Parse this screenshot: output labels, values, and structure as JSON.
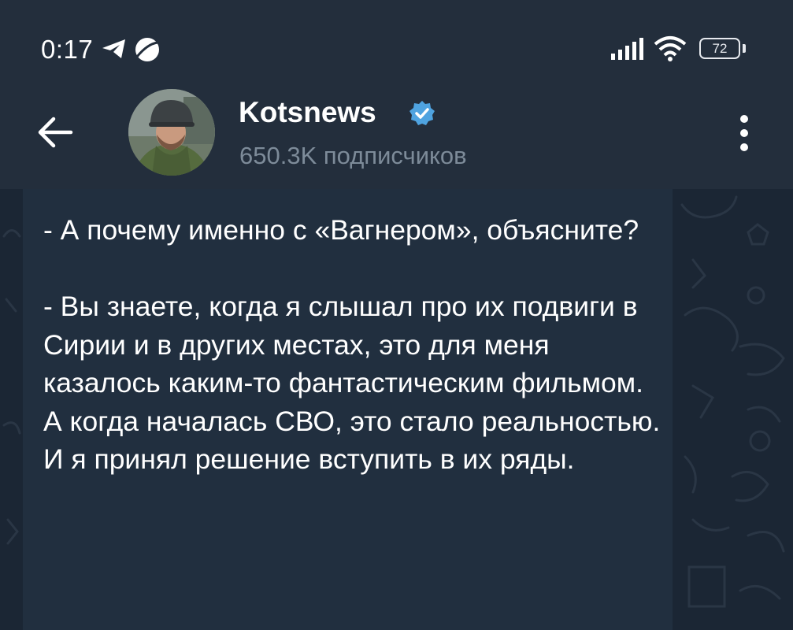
{
  "status_bar": {
    "time": "0:17",
    "battery": "72",
    "icons": [
      "telegram-icon",
      "orbit-icon",
      "signal-icon",
      "wifi-icon",
      "battery-icon"
    ]
  },
  "header": {
    "channel_name": "Kotsnews",
    "subscribers": "650.3K подписчиков",
    "icons": [
      "back-arrow-icon",
      "verified-icon",
      "more-vert-icon"
    ]
  },
  "message": {
    "paragraphs": [
      "- А почему именно с «Вагнером», объясните?",
      "- Вы знаете, когда я слышал про их подвиги в Сирии и в других местах, это для меня казалось каким-то фантастическим фильмом. А когда началась СВО, это стало реальностью. И я принял решение вступить в их ряды."
    ]
  },
  "colors": {
    "header_bg": "#232e3c",
    "chat_bg": "#1b2634",
    "bubble_bg": "#212f3f",
    "accent": "#4fa3e0",
    "secondary_text": "#7d8b99"
  }
}
